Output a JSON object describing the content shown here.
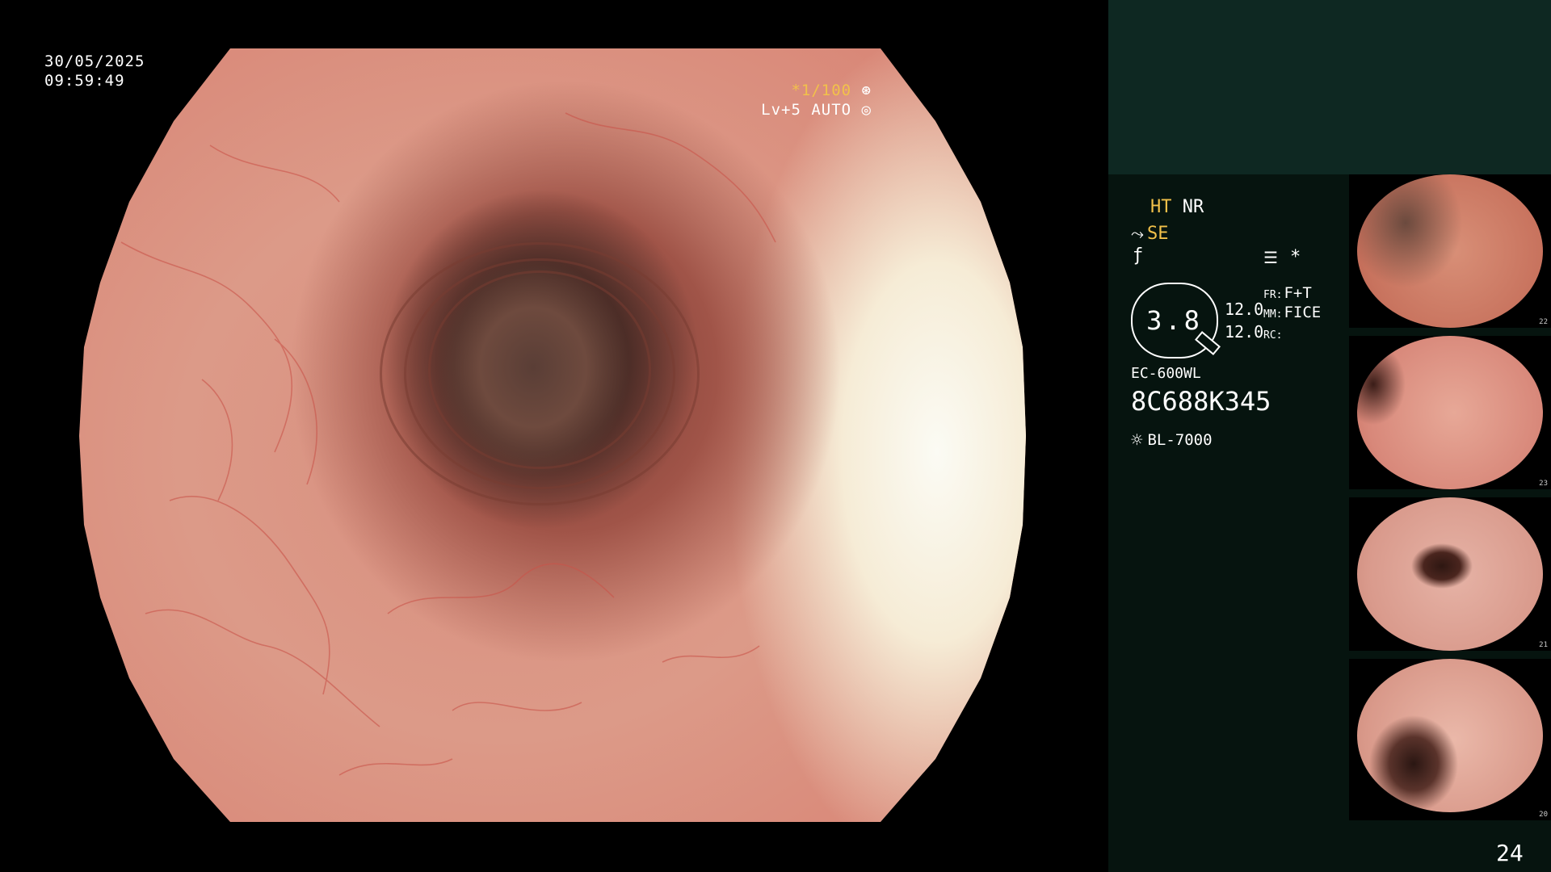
{
  "osd": {
    "date": "30/05/2025",
    "time": "09:59:49",
    "shutter": "*1/100",
    "shutter_icon": "aperture-icon",
    "brightness": "Lv+5 AUTO",
    "brightness_icon": "iris-icon"
  },
  "panel": {
    "mode_ht": "HT",
    "mode_nr": "NR",
    "se_label": "SE",
    "zoom": "3.8",
    "value_a": "12.0",
    "value_b": "12.0",
    "fr_label": "FR:",
    "fr_value": "F+T",
    "mm_label": "MM:",
    "mm_value": "FICE",
    "rc_label": "RC:",
    "scope_model": "EC-600WL",
    "serial": "8C688K345",
    "light_source": "BL-7000",
    "page_number": "24"
  },
  "thumbnails": [
    {
      "number": "22"
    },
    {
      "number": "23"
    },
    {
      "number": "21"
    },
    {
      "number": "20"
    }
  ],
  "colors": {
    "accent_yellow": "#f2c14a",
    "panel_bg": "#06140f",
    "panel_top_bg": "#0e2822"
  }
}
